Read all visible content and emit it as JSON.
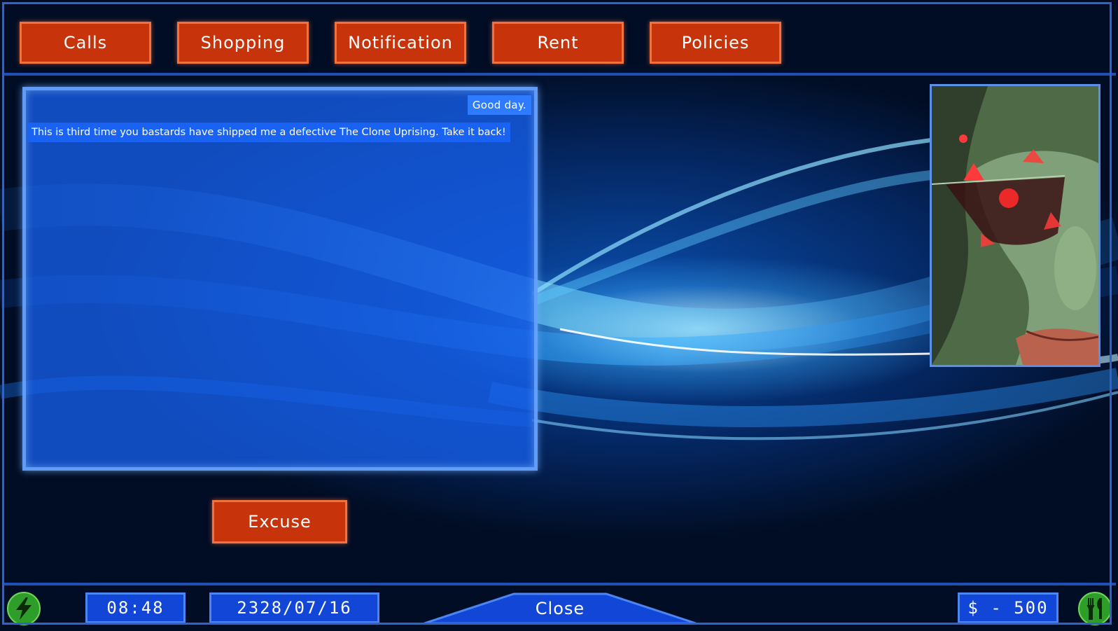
{
  "nav": {
    "tabs": [
      {
        "label": "Calls"
      },
      {
        "label": "Shopping"
      },
      {
        "label": "Notification"
      },
      {
        "label": "Rent"
      },
      {
        "label": "Policies"
      }
    ]
  },
  "message_panel": {
    "greeting": "Good day.",
    "message": "This is third time you bastards have shipped me a defective The Clone Uprising. Take it back!"
  },
  "actions": {
    "excuse_label": "Excuse"
  },
  "status_bar": {
    "time": "08:48",
    "date": "2328/07/16",
    "close_label": "Close",
    "money": "$ - 500",
    "energy_icon": "lightning-icon",
    "food_icon": "fork-knife-icon"
  },
  "colors": {
    "button_fill": "#c7340b",
    "button_border": "#f2723f",
    "panel_blue": "#1a63f2",
    "status_icon_green": "#2f9d2a"
  }
}
